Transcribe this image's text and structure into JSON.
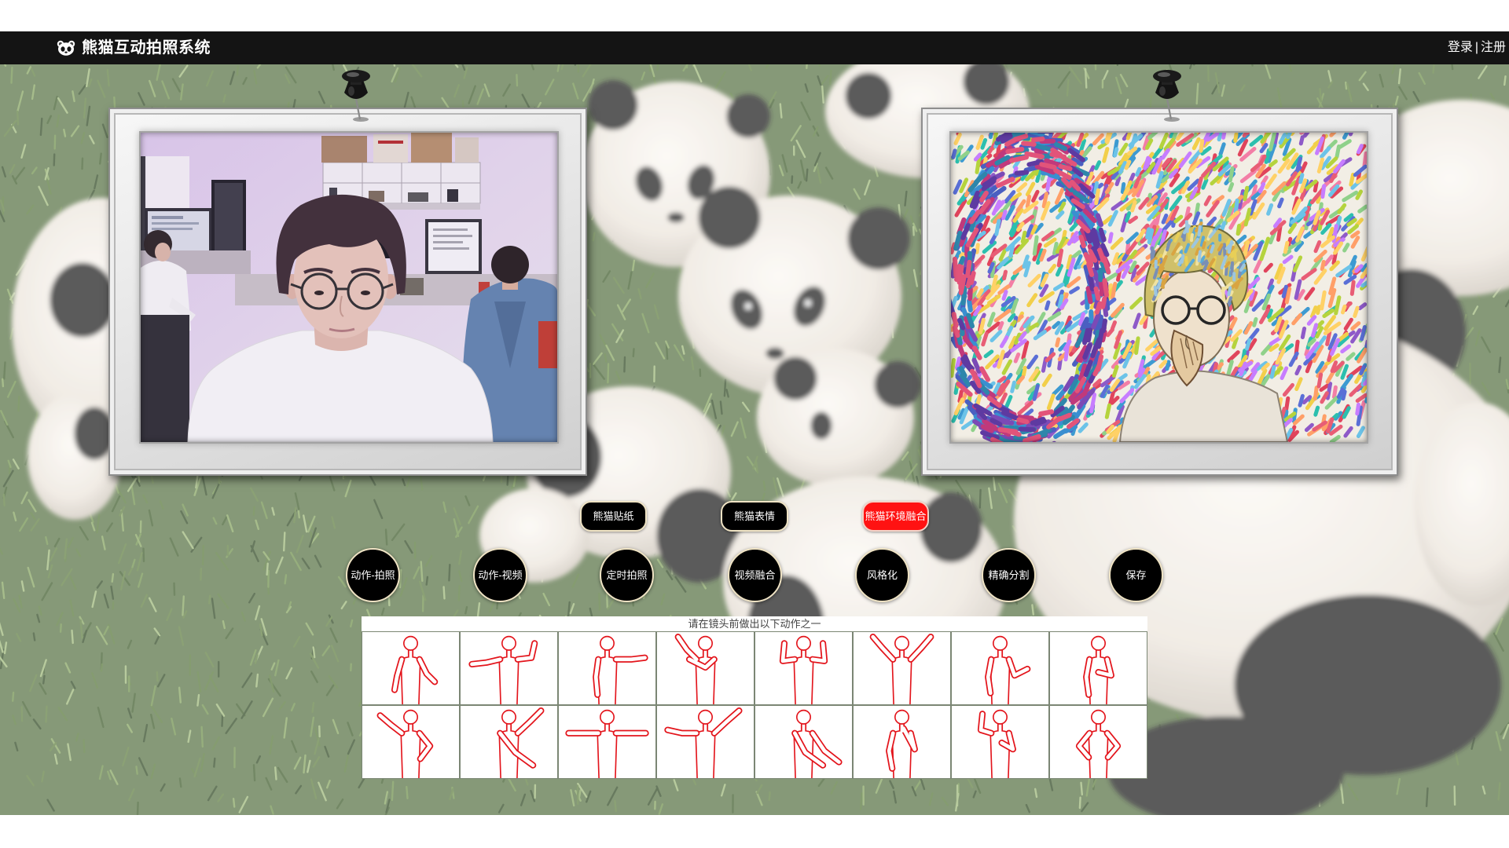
{
  "header": {
    "logo_icon": "panda-icon",
    "title": "熊猫互动拍照系统",
    "login": "登录",
    "separator": "|",
    "register": "注册"
  },
  "frames": {
    "left_pin_icon": "pushpin-icon",
    "right_pin_icon": "pushpin-icon"
  },
  "mode_buttons": [
    {
      "label": "熊猫贴纸",
      "active": false
    },
    {
      "label": "熊猫表情",
      "active": false
    },
    {
      "label": "熊猫环境融合",
      "active": true
    }
  ],
  "action_buttons": [
    {
      "label": "动作-拍照"
    },
    {
      "label": "动作-视频"
    },
    {
      "label": "定时拍照"
    },
    {
      "label": "视频融合"
    },
    {
      "label": "风格化"
    },
    {
      "label": "精确分割"
    },
    {
      "label": "保存"
    }
  ],
  "pose_panel": {
    "title": "请在镜头前做出以下动作之一",
    "pose_icons": [
      "pose-arms-low-icon",
      "pose-arm-extended-icon",
      "pose-one-arm-out-icon",
      "pose-arms-diagonal-icon",
      "pose-double-flex-icon",
      "pose-arms-up-v-icon",
      "pose-palm-up-icon",
      "pose-hand-on-chest-icon",
      "pose-arm-raised-hip-icon",
      "pose-arm-up-right-icon",
      "pose-t-pose-icon",
      "pose-arm-up-side-icon",
      "pose-arms-forward-down-icon",
      "pose-hand-on-chin-icon",
      "pose-flex-and-chest-icon",
      "pose-hands-on-hips-icon"
    ]
  },
  "colors": {
    "header_bg": "#141414",
    "button_bg": "#000000",
    "button_border": "#efe3c4",
    "active_button_bg": "#ff1212",
    "pose_stroke": "#e3141b"
  }
}
